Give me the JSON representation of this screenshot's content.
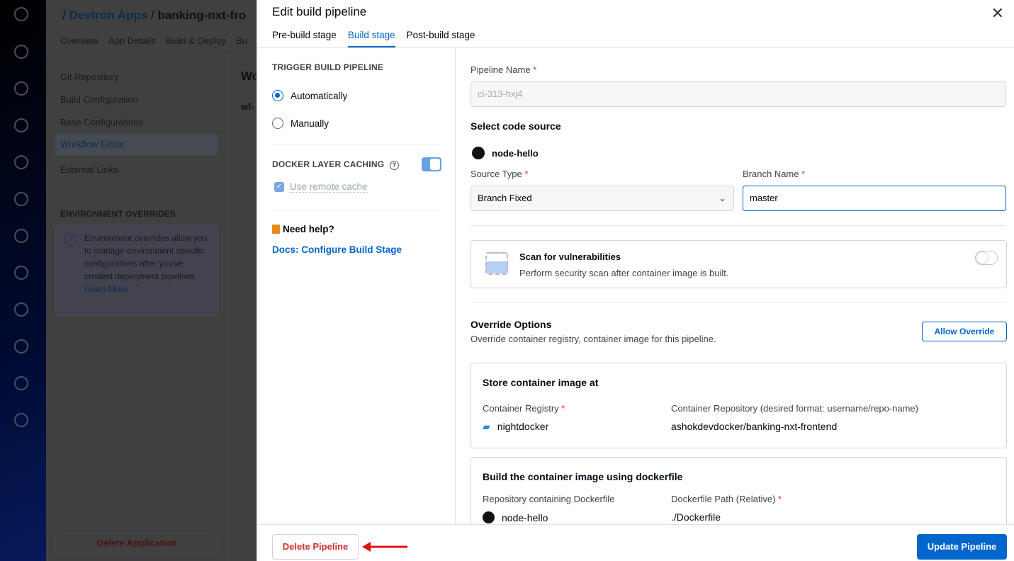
{
  "background": {
    "breadcrumb": {
      "parent": "Devtron Apps",
      "current": "banking-nxt-fro"
    },
    "tabs": [
      "Overview",
      "App Details",
      "Build & Deploy",
      "Bu"
    ],
    "sidenav": [
      "Git Repository",
      "Build Configuration",
      "Base Configurations",
      "Workflow Editor",
      "External Links"
    ],
    "workflow_title": "Wo",
    "workflow_name": "wf-",
    "env_overrides_heading": "ENVIRONMENT OVERRIDES",
    "env_overrides_text": "Environment overrides allow you to manage environment specific configurations after you've created deployment pipelines.",
    "learn_more": "Learn More",
    "delete_application": "Delete Application"
  },
  "modal": {
    "title": "Edit build pipeline",
    "tabs": [
      {
        "label": "Pre-build stage",
        "active": false
      },
      {
        "label": "Build stage",
        "active": true
      },
      {
        "label": "Post-build stage",
        "active": false
      }
    ],
    "left": {
      "trigger_heading": "TRIGGER BUILD PIPELINE",
      "trigger_options": [
        "Automatically",
        "Manually"
      ],
      "trigger_selected": "Automatically",
      "docker_caching_heading": "DOCKER LAYER CACHING",
      "docker_caching_enabled": true,
      "use_remote_cache": "Use remote cache",
      "use_remote_cache_checked": true,
      "need_help": "Need help?",
      "docs_link": "Docs: Configure Build Stage"
    },
    "right": {
      "pipeline_name_label": "Pipeline Name",
      "pipeline_name_placeholder": "ci-313-hxj4",
      "code_source_heading": "Select code source",
      "repo_name": "node-hello",
      "source_type_label": "Source Type",
      "source_type_value": "Branch Fixed",
      "branch_name_label": "Branch Name",
      "branch_name_value": "master",
      "scan_title": "Scan for vulnerabilities",
      "scan_desc": "Perform security scan after container image is built.",
      "scan_enabled": false,
      "override_title": "Override Options",
      "override_desc": "Override container registry, container image for this pipeline.",
      "allow_override": "Allow Override",
      "store_title": "Store container image at",
      "registry_label": "Container Registry",
      "registry_value": "nightdocker",
      "repository_label": "Container Repository (desired format: username/repo-name)",
      "repository_value": "ashokdevdocker/banking-nxt-frontend",
      "build_title": "Build the container image using dockerfile",
      "dockerfile_repo_label": "Repository containing Dockerfile",
      "dockerfile_repo_value": "node-hello",
      "dockerfile_path_label": "Dockerfile Path (Relative)",
      "dockerfile_path_value": "./Dockerfile"
    },
    "footer": {
      "delete": "Delete Pipeline",
      "update": "Update Pipeline"
    }
  },
  "colors": {
    "accent": "#0066cc",
    "danger": "#d32f2f",
    "annotation_arrow": "#e01010"
  }
}
